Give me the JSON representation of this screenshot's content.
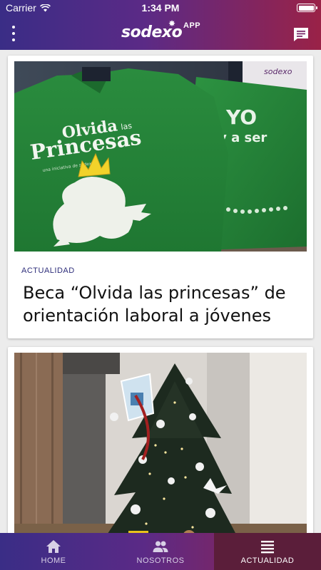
{
  "status_bar": {
    "carrier": "Carrier",
    "time": "1:34 PM"
  },
  "header": {
    "logo": "sodexo",
    "app_label": "APP"
  },
  "feed": {
    "cards": [
      {
        "category": "ACTUALIDAD",
        "title": "Beca “Olvida las princesas” de orientación laboral a jóvenes",
        "image": {
          "shirt_left_line1": "Olvida",
          "shirt_left_small": "las",
          "shirt_left_line2": "Princesas",
          "shirt_left_tagline": "una iniciativa de sodexo",
          "shirt_right_line1": "YO",
          "shirt_right_line2": "voy a ser",
          "box_logo": "sodexo"
        }
      },
      {
        "category": "",
        "title": ""
      }
    ]
  },
  "tabbar": {
    "tabs": [
      {
        "label": "HOME",
        "icon": "home-icon",
        "active": false
      },
      {
        "label": "NOSOTROS",
        "icon": "people-icon",
        "active": false
      },
      {
        "label": "ACTUALIDAD",
        "icon": "list-icon",
        "active": true
      }
    ]
  },
  "colors": {
    "brand_gradient_start": "#3a2d86",
    "brand_gradient_end": "#9a2247",
    "active_tab": "#5b1e3a",
    "category_text": "#2d2d7a"
  }
}
